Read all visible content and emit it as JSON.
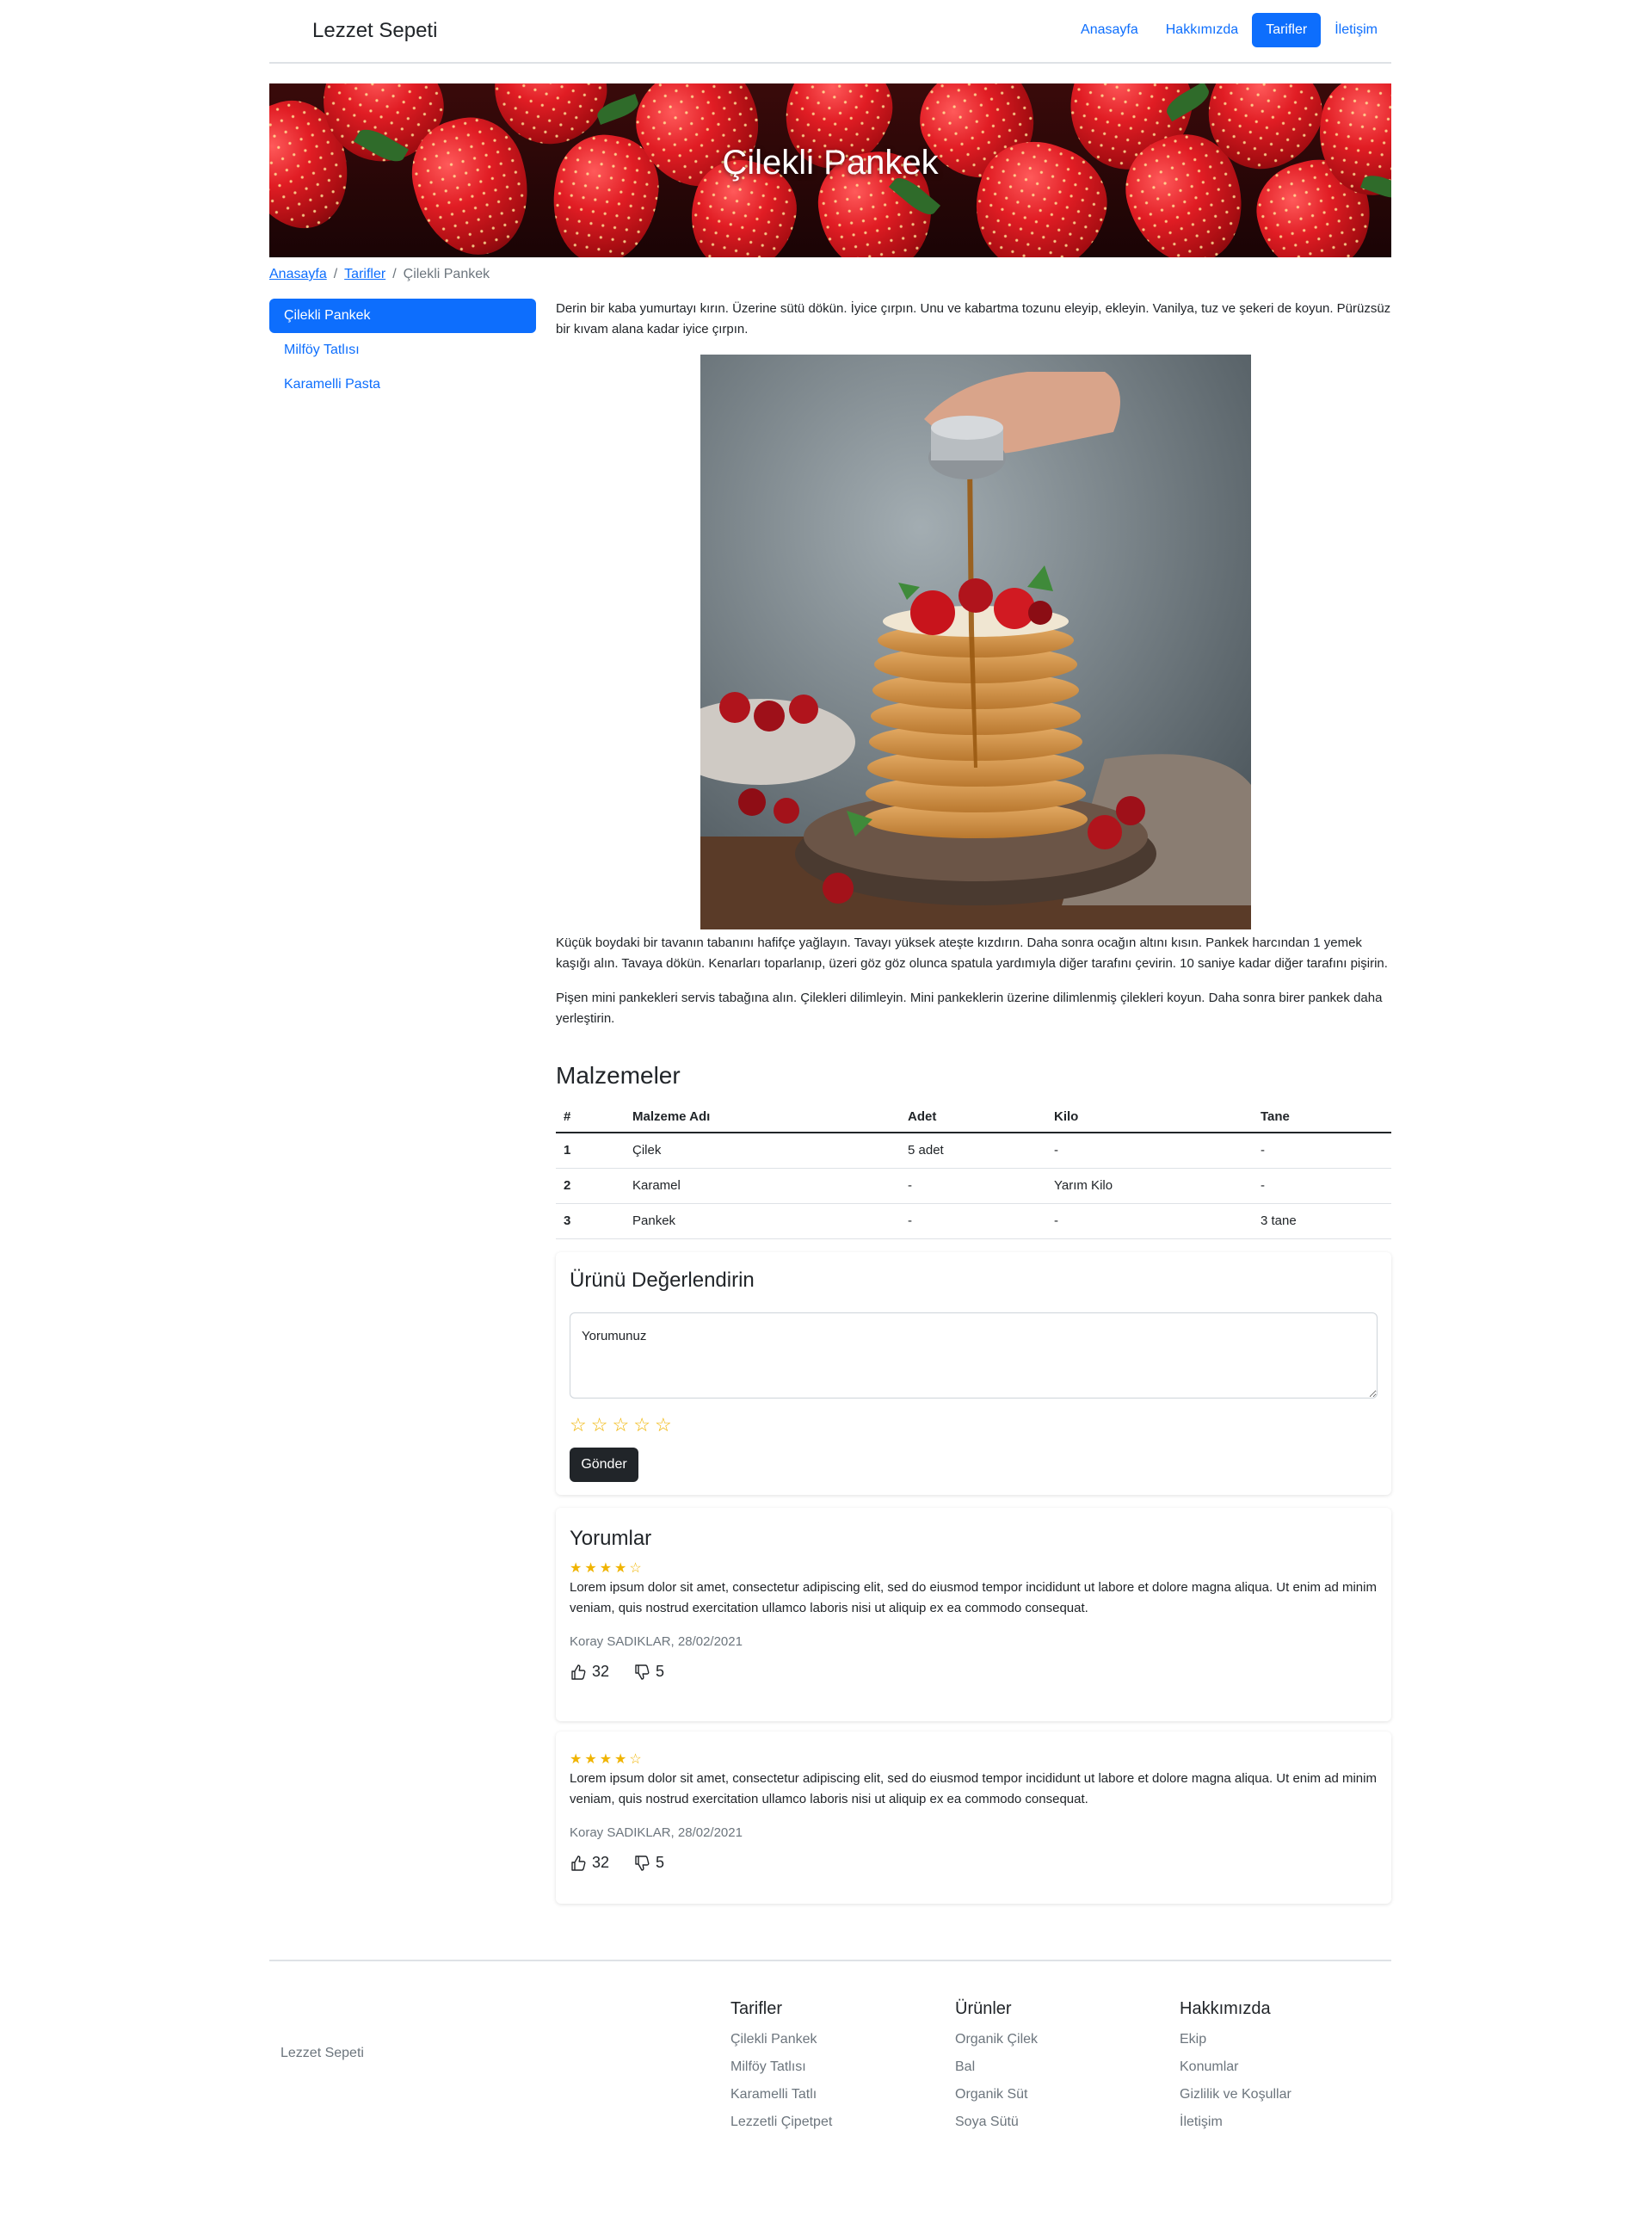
{
  "navbar": {
    "brand": "Lezzet Sepeti",
    "links": [
      {
        "label": "Anasayfa",
        "active": false
      },
      {
        "label": "Hakkımızda",
        "active": false
      },
      {
        "label": "Tarifler",
        "active": true
      },
      {
        "label": "İletişim",
        "active": false
      }
    ]
  },
  "hero": {
    "title": "Çilekli Pankek"
  },
  "breadcrumb": {
    "items": [
      "Anasayfa",
      "Tarifler",
      "Çilekli Pankek"
    ],
    "separator": "/"
  },
  "sidebar": {
    "items": [
      {
        "label": "Çilekli Pankek",
        "active": true
      },
      {
        "label": "Milföy Tatlısı",
        "active": false
      },
      {
        "label": "Karamelli Pasta",
        "active": false
      }
    ]
  },
  "recipe": {
    "step1": "Derin bir kaba yumurtayı kırın. Üzerine sütü dökün. İyice çırpın. Unu ve kabartma tozunu eleyip, ekleyin. Vanilya, tuz ve şekeri de koyun. Pürüzsüz bir kıvam alana kadar iyice çırpın.",
    "step2": "Küçük boydaki bir tavanın tabanını hafifçe yağlayın. Tavayı yüksek ateşte kızdırın. Daha sonra ocağın altını kısın. Pankek harcından 1 yemek kaşığı alın. Tavaya dökün. Kenarları toparlanıp, üzeri göz göz olunca spatula yardımıyla diğer tarafını çevirin. 10 saniye kadar diğer tarafını pişirin.",
    "step3": "Pişen mini pankekleri servis tabağına alın. Çilekleri dilimleyin. Mini pankeklerin üzerine dilimlenmiş çilekleri koyun. Daha sonra birer pankek daha yerleştirin."
  },
  "ingredients": {
    "title": "Malzemeler",
    "headers": [
      "#",
      "Malzeme Adı",
      "Adet",
      "Kilo",
      "Tane"
    ],
    "rows": [
      [
        "1",
        "Çilek",
        "5 adet",
        "-",
        "-"
      ],
      [
        "2",
        "Karamel",
        "-",
        "Yarım Kilo",
        "-"
      ],
      [
        "3",
        "Pankek",
        "-",
        "-",
        "3 tane"
      ]
    ]
  },
  "review_form": {
    "title": "Ürünü Değerlendirin",
    "placeholder": "Yorumunuz",
    "rating": 0,
    "max_rating": 5,
    "submit_label": "Gönder"
  },
  "comments": {
    "title": "Yorumlar",
    "items": [
      {
        "rating": 4,
        "text": "Lorem ipsum dolor sit amet, consectetur adipiscing elit, sed do eiusmod tempor incididunt ut labore et dolore magna aliqua. Ut enim ad minim veniam, quis nostrud exercitation ullamco laboris nisi ut aliquip ex ea commodo consequat.",
        "author_date": "Koray SADIKLAR, 28/02/2021",
        "likes": "32",
        "dislikes": "5"
      },
      {
        "rating": 4,
        "text": "Lorem ipsum dolor sit amet, consectetur adipiscing elit, sed do eiusmod tempor incididunt ut labore et dolore magna aliqua. Ut enim ad minim veniam, quis nostrud exercitation ullamco laboris nisi ut aliquip ex ea commodo consequat.",
        "author_date": "Koray SADIKLAR, 28/02/2021",
        "likes": "32",
        "dislikes": "5"
      }
    ]
  },
  "footer": {
    "brand": "Lezzet Sepeti",
    "columns": [
      {
        "title": "Tarifler",
        "links": [
          "Çilekli Pankek",
          "Milföy Tatlısı",
          "Karamelli Tatlı",
          "Lezzetli Çipetpet"
        ]
      },
      {
        "title": "Ürünler",
        "links": [
          "Organik Çilek",
          "Bal",
          "Organik Süt",
          "Soya Sütü"
        ]
      },
      {
        "title": "Hakkımızda",
        "links": [
          "Ekip",
          "Konumlar",
          "Gizlilik ve Koşullar",
          "İletişim"
        ]
      }
    ]
  },
  "colors": {
    "primary": "#0d6efd",
    "dark": "#212529",
    "star": "#f0b400",
    "muted": "#6c757d"
  }
}
